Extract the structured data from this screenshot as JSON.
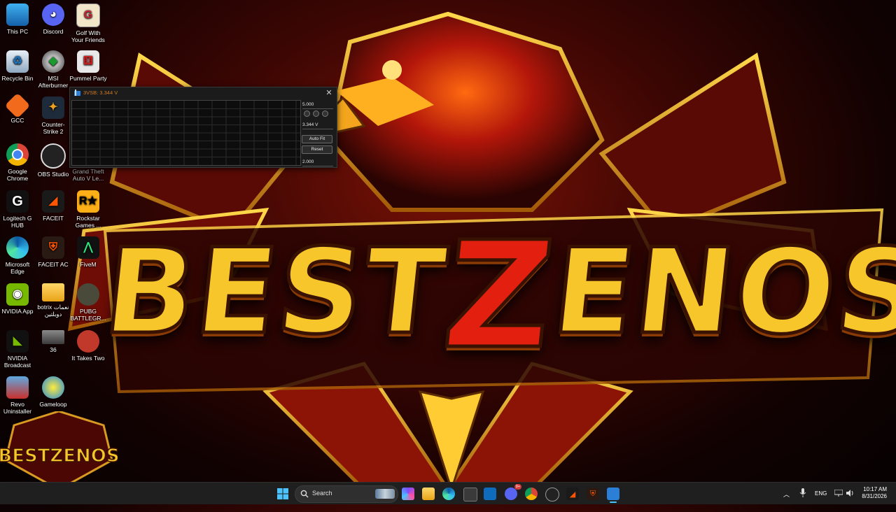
{
  "wallpaper": {
    "title_a": "BEST",
    "title_z": "Z",
    "title_b": "ENOS",
    "logo_text": "BESTZENOS"
  },
  "desktop_icons": [
    {
      "label": "This PC"
    },
    {
      "label": "Discord"
    },
    {
      "label": "Golf With Your Friends"
    },
    {
      "label": "Recycle Bin"
    },
    {
      "label": "MSI Afterburner"
    },
    {
      "label": "Pummel Party"
    },
    {
      "label": "GCC"
    },
    {
      "label": "Counter-Strike 2"
    },
    {
      "label": "Google Chrome"
    },
    {
      "label": "OBS Studio"
    },
    {
      "label": "Grand Theft Auto V Le..."
    },
    {
      "label": "Logitech G HUB"
    },
    {
      "label": "FACEIT"
    },
    {
      "label": "Rockstar Games ..."
    },
    {
      "label": "Microsoft Edge"
    },
    {
      "label": "FACEIT AC"
    },
    {
      "label": "FiveM"
    },
    {
      "label": "NVIDIA App"
    },
    {
      "label": "botrix نعمات دوبلتين"
    },
    {
      "label": "PUBG BATTLEGR..."
    },
    {
      "label": "NVIDIA Broadcast"
    },
    {
      "label": "36"
    },
    {
      "label": "It Takes Two"
    },
    {
      "label": "Revo Uninstaller"
    },
    {
      "label": "Gameloop"
    }
  ],
  "monitor_window": {
    "title": "3VSB: 3.344 V",
    "max_value": "5.000",
    "current_value": "3.344 V",
    "min_value": "2.000",
    "auto_fit_label": "Auto Fit",
    "reset_label": "Reset"
  },
  "taskbar": {
    "search_placeholder": "Search",
    "language": "ENG",
    "time": "10:17 AM",
    "date": "8/31/2026",
    "discord_badge": "9+",
    "accent": "#4cc2ff"
  },
  "colors": {
    "title_gold": "#f6c62a",
    "title_red": "#e32010",
    "monitor_title": "#d07a24"
  }
}
